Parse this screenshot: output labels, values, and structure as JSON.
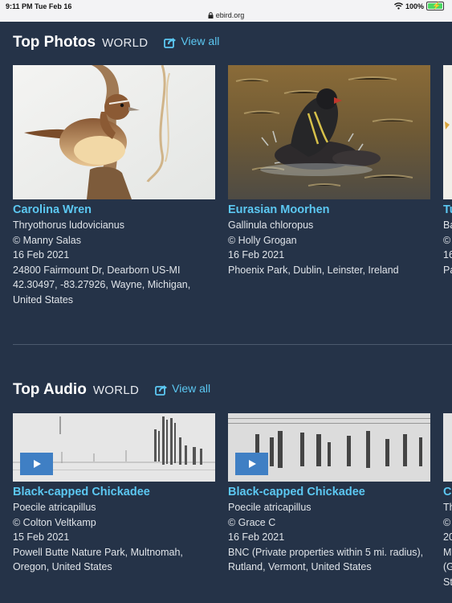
{
  "status": {
    "time": "9:11 PM",
    "date": "Tue Feb 16",
    "url": "ebird.org",
    "battery": "100%",
    "battery_level": 1.0
  },
  "photos": {
    "title": "Top Photos",
    "region": "WORLD",
    "view_all": "View all",
    "cards": [
      {
        "name": "Carolina Wren",
        "sci": "Thryothorus ludovicianus",
        "credit": "© Manny Salas",
        "date": "16 Feb 2021",
        "location": "24800 Fairmount Dr, Dearborn US-MI 42.30497, -83.27926, Wayne, Michigan, United States"
      },
      {
        "name": "Eurasian Moorhen",
        "sci": "Gallinula chloropus",
        "credit": "© Holly Grogan",
        "date": "16 Feb 2021",
        "location": "Phoenix Park, Dublin, Leinster, Ireland"
      },
      {
        "name": "Tu",
        "sci": "Ba",
        "credit": "©",
        "date": "16",
        "location": "Pa"
      }
    ]
  },
  "audio": {
    "title": "Top Audio",
    "region": "WORLD",
    "view_all": "View all",
    "cards": [
      {
        "name": "Black-capped Chickadee",
        "sci": "Poecile atricapillus",
        "credit": "© Colton Veltkamp",
        "date": "15 Feb 2021",
        "location": "Powell Butte Nature Park, Multnomah, Oregon, United States"
      },
      {
        "name": "Black-capped Chickadee",
        "sci": "Poecile atricapillus",
        "credit": "© Grace C",
        "date": "16 Feb 2021",
        "location": "BNC (Private properties within 5 mi. radius), Rutland, Vermont, United States"
      },
      {
        "name": "C",
        "sci": "Th",
        "credit": "©",
        "date": "20",
        "location_lines": [
          "M",
          "(G",
          "St"
        ]
      }
    ]
  }
}
